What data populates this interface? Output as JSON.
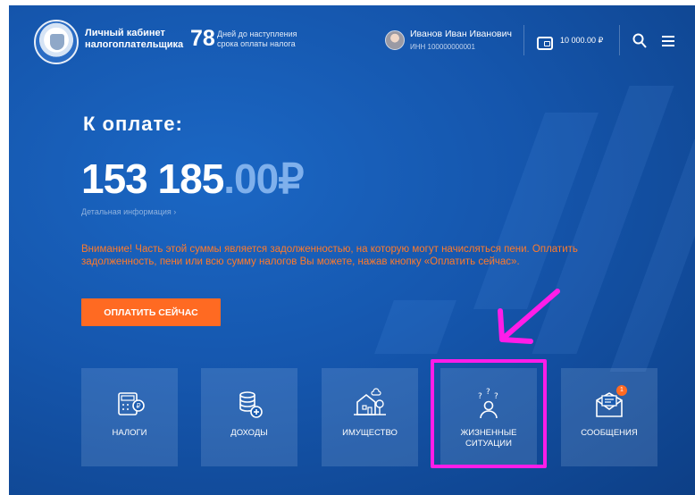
{
  "header": {
    "title_line1": "Личный кабинет",
    "title_line2": "налогоплательщика",
    "days_count": "78",
    "days_text_line1": "Дней до наступления",
    "days_text_line2": "срока оплаты налога",
    "user_name": "Иванов Иван Иванович",
    "user_inn": "ИНН 100000000001",
    "balance": "10 000.00 ₽"
  },
  "main": {
    "pay_label": "К оплате:",
    "amount_int": "153 185",
    "amount_dec": ".00₽",
    "details_link": "Детальная информация ›",
    "warning_text": "Внимание! Часть этой суммы является задолженностью, на которую могут начисляться пени. Оплатить задолженность, пени или всю сумму налогов Вы можете, нажав кнопку «Оплатить сейчас».",
    "pay_button": "ОПЛАТИТЬ СЕЙЧАС"
  },
  "tiles": [
    {
      "label": "НАЛОГИ",
      "icon": "calculator-ruble-icon"
    },
    {
      "label": "ДОХОДЫ",
      "icon": "coins-plus-icon"
    },
    {
      "label": "ИМУЩЕСТВО",
      "icon": "house-tree-icon"
    },
    {
      "label_line1": "ЖИЗНЕННЫЕ",
      "label_line2": "СИТУАЦИИ",
      "icon": "person-questions-icon"
    },
    {
      "label": "СООБЩЕНИЯ",
      "icon": "envelope-icon",
      "badge": "1"
    }
  ],
  "colors": {
    "accent": "#ff6a22",
    "highlight": "#ff1de8",
    "background": "#1556ad"
  }
}
